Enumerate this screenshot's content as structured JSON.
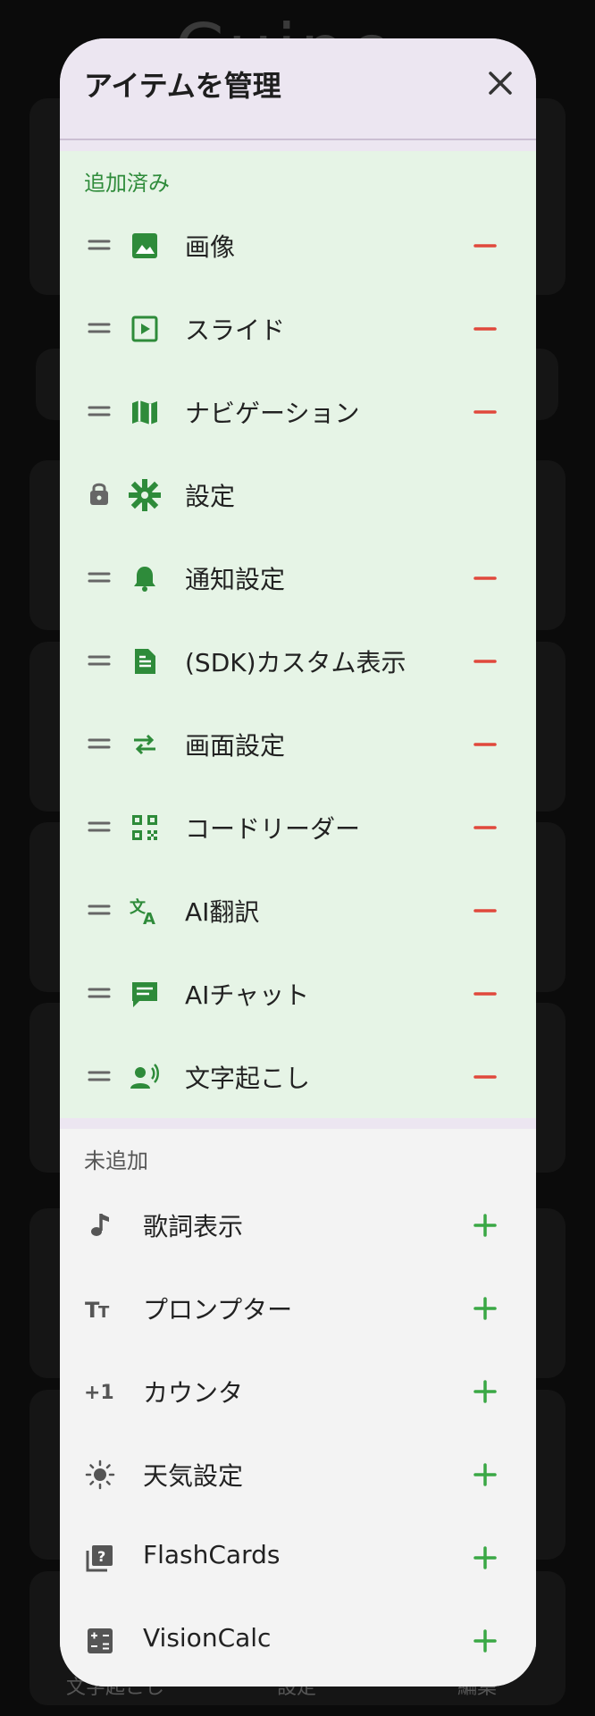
{
  "background": {
    "title": "Cuipe",
    "bottom_tabs": [
      "文字起こし",
      "設定",
      "編集"
    ]
  },
  "modal": {
    "title": "アイテムを管理",
    "added_label": "追加済み",
    "not_added_label": "未追加",
    "added_items": [
      {
        "label": "画像",
        "icon": "image-icon",
        "locked": false
      },
      {
        "label": "スライド",
        "icon": "slideshow-icon",
        "locked": false
      },
      {
        "label": "ナビゲーション",
        "icon": "map-icon",
        "locked": false
      },
      {
        "label": "設定",
        "icon": "gear-icon",
        "locked": true
      },
      {
        "label": "通知設定",
        "icon": "bell-icon",
        "locked": false
      },
      {
        "label": "(SDK)カスタム表示",
        "icon": "document-icon",
        "locked": false
      },
      {
        "label": "画面設定",
        "icon": "swap-arrows-icon",
        "locked": false
      },
      {
        "label": "コードリーダー",
        "icon": "qr-code-icon",
        "locked": false
      },
      {
        "label": "AI翻訳",
        "icon": "translate-icon",
        "locked": false
      },
      {
        "label": "AIチャット",
        "icon": "chat-icon",
        "locked": false
      },
      {
        "label": "文字起こし",
        "icon": "voice-person-icon",
        "locked": false
      }
    ],
    "not_added_items": [
      {
        "label": "歌詞表示",
        "icon": "music-note-icon"
      },
      {
        "label": "プロンプター",
        "icon": "text-size-icon"
      },
      {
        "label": "カウンタ",
        "icon": "plus-one-icon",
        "glyph": "+1"
      },
      {
        "label": "天気設定",
        "icon": "sun-icon"
      },
      {
        "label": "FlashCards",
        "icon": "quiz-icon"
      },
      {
        "label": "VisionCalc",
        "icon": "calculator-icon"
      }
    ]
  },
  "colors": {
    "accent_green": "#2e8b3a",
    "remove_red": "#e0483c",
    "add_green": "#3aa845"
  }
}
